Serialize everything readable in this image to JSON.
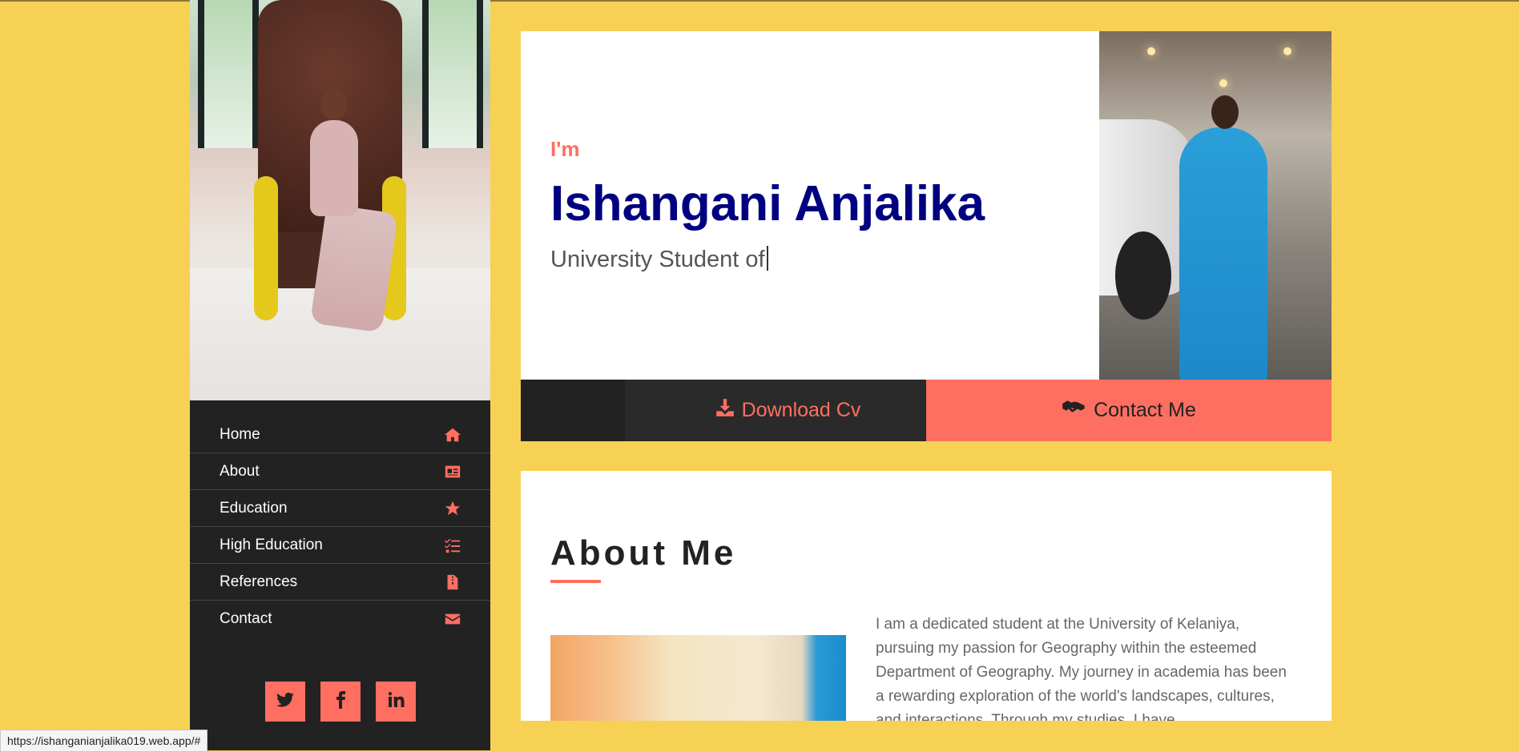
{
  "sidebar": {
    "nav": [
      {
        "label": "Home",
        "icon": "home-icon"
      },
      {
        "label": "About",
        "icon": "id-card-icon"
      },
      {
        "label": "Education",
        "icon": "star-icon"
      },
      {
        "label": "High Education",
        "icon": "tasks-icon"
      },
      {
        "label": "References",
        "icon": "file-icon"
      },
      {
        "label": "Contact",
        "icon": "envelope-icon"
      }
    ],
    "social": [
      {
        "icon": "twitter-icon"
      },
      {
        "icon": "facebook-icon"
      },
      {
        "icon": "linkedin-icon"
      }
    ]
  },
  "hero": {
    "intro": "I'm",
    "name": "Ishangani Anjalika",
    "role": "University Student of",
    "download_label": "Download Cv",
    "contact_label": "Contact Me"
  },
  "about": {
    "title": "About Me",
    "text": "I am a dedicated student at the University of Kelaniya, pursuing my passion for Geography within the esteemed Department of Geography. My journey in academia has been a rewarding exploration of the world's landscapes, cultures, and interactions. Through my studies, I have"
  },
  "status_bar": {
    "url": "https://ishanganianjalika019.web.app/#"
  },
  "colors": {
    "background": "#f7d154",
    "accent": "#ff6f61",
    "sidebar": "#222222",
    "name": "#000080"
  }
}
